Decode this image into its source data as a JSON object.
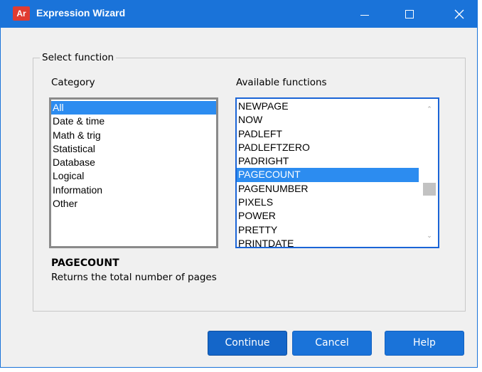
{
  "window": {
    "title": "Expression Wizard",
    "app_icon_text": "Ar",
    "accent_color": "#1a73d9"
  },
  "group": {
    "legend": "Select function",
    "category_label": "Category",
    "functions_label": "Available functions"
  },
  "categories": {
    "items": [
      "All",
      "Date & time",
      "Math & trig",
      "Statistical",
      "Database",
      "Logical",
      "Information",
      "Other"
    ],
    "selected": "All"
  },
  "functions": {
    "items": [
      "NEWPAGE",
      "NOW",
      "PADLEFT",
      "PADLEFTZERO",
      "PADRIGHT",
      "PAGECOUNT",
      "PAGENUMBER",
      "PIXELS",
      "POWER",
      "PRETTY",
      "PRINTDATE"
    ],
    "selected": "PAGECOUNT"
  },
  "description": {
    "name": "PAGECOUNT",
    "text": "Returns the total number of pages"
  },
  "buttons": {
    "continue": "Continue",
    "cancel": "Cancel",
    "help": "Help"
  }
}
